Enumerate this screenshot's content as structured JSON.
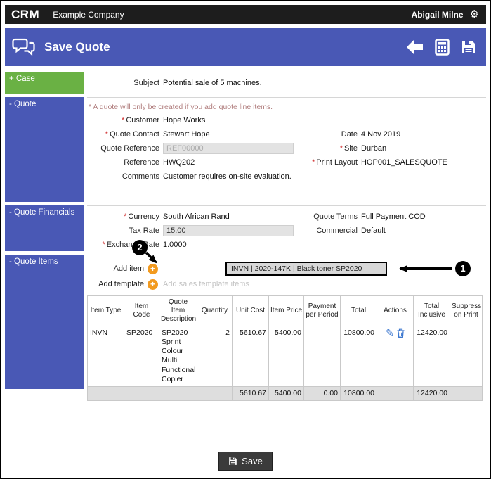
{
  "topbar": {
    "logo": "CRM",
    "company": "Example Company",
    "user": "Abigail Milne"
  },
  "header": {
    "title": "Save Quote"
  },
  "misc": {
    "required_marker": "*",
    "plus_icon": "+",
    "gear_icon": "⚙",
    "pencil_icon": "✎"
  },
  "case": {
    "tab": "+ Case",
    "subject_label": "Subject",
    "subject_value": "Potential sale of 5 machines."
  },
  "quote": {
    "tab": "- Quote",
    "note": "* A quote will only be created if you add quote line items.",
    "customer_label": "Customer",
    "customer_value": "Hope Works",
    "contact_label": "Quote Contact",
    "contact_value": "Stewart Hope",
    "quote_ref_label": "Quote Reference",
    "quote_ref_value": "REF00000",
    "reference_label": "Reference",
    "reference_value": "HWQ202",
    "comments_label": "Comments",
    "comments_value": "Customer requires on-site evaluation.",
    "date_label": "Date",
    "date_value": "4 Nov 2019",
    "site_label": "Site",
    "site_value": "Durban",
    "print_layout_label": "Print Layout",
    "print_layout_value": "HOP001_SALESQUOTE"
  },
  "financials": {
    "tab": "- Quote Financials",
    "currency_label": "Currency",
    "currency_value": "South African Rand",
    "tax_label": "Tax Rate",
    "tax_value": "15.00",
    "exchange_label": "Exchange Rate",
    "exchange_value": "1.0000",
    "terms_label": "Quote Terms",
    "terms_value": "Full Payment COD",
    "commercial_label": "Commercial",
    "commercial_value": "Default"
  },
  "items": {
    "tab": "- Quote Items",
    "add_item_label": "Add item",
    "item_select_value": "INVN | 2020-147K | Black toner SP2020",
    "add_template_label": "Add template",
    "add_template_placeholder": "Add sales template items",
    "table": {
      "headers": [
        "Item Type",
        "Item Code",
        "Quote Item Description",
        "Quantity",
        "Unit Cost",
        "Item Price",
        "Payment per Period",
        "Total",
        "Actions",
        "Total Inclusive",
        "Suppress on Print"
      ],
      "row": {
        "item_type": "INVN",
        "item_code": "SP2020",
        "description": "SP2020 Sprint Colour Multi Functional Copier",
        "quantity": "2",
        "unit_cost": "5610.67",
        "item_price": "5400.00",
        "payment_per_period": "",
        "total": "10800.00",
        "total_inclusive": "12420.00",
        "suppress": ""
      },
      "totals": {
        "unit_cost": "5610.67",
        "item_price": "5400.00",
        "payment_per_period": "0.00",
        "total": "10800.00",
        "total_inclusive": "12420.00"
      }
    }
  },
  "annotations": {
    "callout_1": "1",
    "callout_2": "2"
  },
  "footer": {
    "save_label": "Save"
  },
  "colors": {
    "brand_blue": "#4958b5",
    "case_green": "#6ab144",
    "add_orange": "#f29a1f",
    "topbar_black": "#1d1d1d",
    "action_blue": "#3c77cf"
  }
}
